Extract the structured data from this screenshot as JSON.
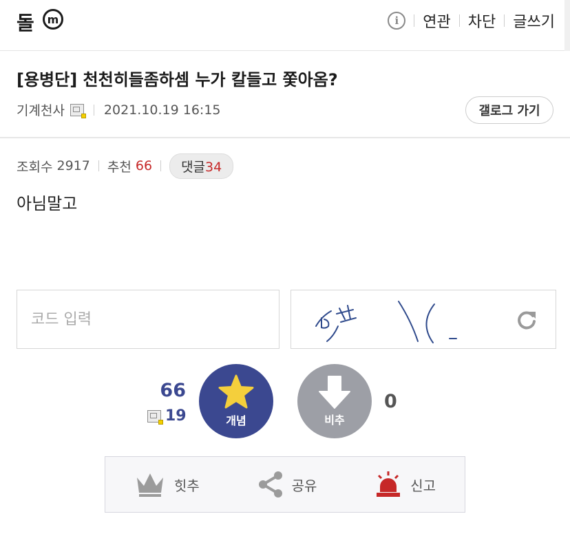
{
  "header": {
    "logo_text": "돌",
    "logo_badge": "m",
    "menu": [
      "연관",
      "차단",
      "글쓰기"
    ],
    "info_icon": "info-icon"
  },
  "post": {
    "title": "[용병단] 천천히들좀하셈 누가 칼들고 쫓아옴?",
    "author": "기계천사",
    "datetime": "2021.10.19 16:15",
    "gallery_button": "갤로그 가기",
    "stats": {
      "views_label": "조회수",
      "views": "2917",
      "recommend_label": "추천",
      "recommend": "66",
      "comments_label": "댓글",
      "comments": "34"
    },
    "body": "아님말고"
  },
  "captcha": {
    "placeholder": "코드 입력"
  },
  "vote": {
    "up_count": "66",
    "up_fixed_count": "19",
    "up_label": "개념",
    "down_label": "비추",
    "down_count": "0"
  },
  "actions": [
    {
      "label": "힛추",
      "icon": "crown-icon"
    },
    {
      "label": "공유",
      "icon": "share-icon"
    },
    {
      "label": "신고",
      "icon": "siren-icon"
    }
  ],
  "colors": {
    "accent": "#3b4890",
    "red": "#c62828",
    "downvote": "#9d9fa6"
  }
}
